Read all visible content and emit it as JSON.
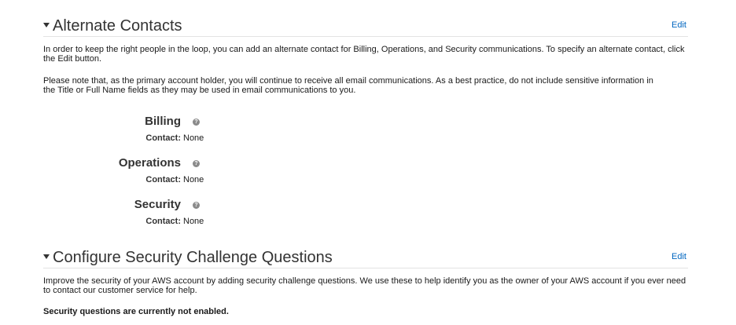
{
  "alternate_contacts": {
    "title": "Alternate Contacts",
    "edit_label": "Edit",
    "intro": "In order to keep the right people in the loop, you can add an alternate contact for Billing, Operations, and Security communications. To specify an alternate contact, click the Edit button.",
    "note": "Please note that, as the primary account holder, you will continue to receive all email communications. As a best practice, do not include sensitive information in the Title or Full Name fields as they may be used in email communications to you.",
    "contacts": [
      {
        "name": "Billing",
        "label": "Contact:",
        "value": "None"
      },
      {
        "name": "Operations",
        "label": "Contact:",
        "value": "None"
      },
      {
        "name": "Security",
        "label": "Contact:",
        "value": "None"
      }
    ]
  },
  "security_questions": {
    "title": "Configure Security Challenge Questions",
    "edit_label": "Edit",
    "intro": "Improve the security of your AWS account by adding security challenge questions. We use these to help identify you as the owner of your AWS account if you ever need to contact our customer service for help.",
    "status": "Security questions are currently not enabled."
  },
  "icons": {
    "help": "question-circle-icon",
    "caret": "caret-down-icon"
  },
  "colors": {
    "link": "#0066c0",
    "heading": "#333333",
    "help_icon": "#8a8a8a"
  }
}
